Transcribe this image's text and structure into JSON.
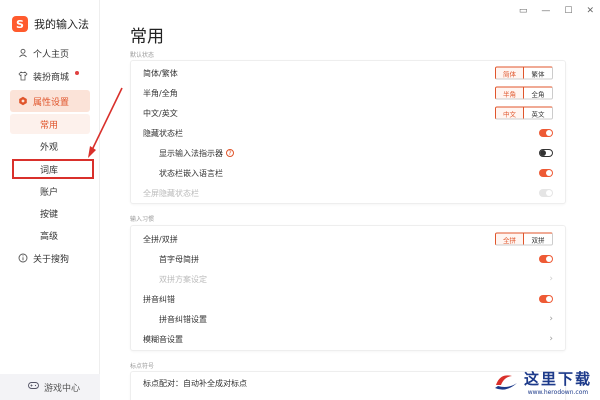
{
  "app": {
    "title": "我的输入法",
    "logo_char": "S"
  },
  "window_controls": [
    "▭",
    "—",
    "☐",
    "✕"
  ],
  "sidebar": {
    "items": [
      {
        "label": "个人主页",
        "icon": "user-icon"
      },
      {
        "label": "装扮商城",
        "icon": "shirt-icon",
        "has_dot": true
      },
      {
        "label": "属性设置",
        "icon": "settings-icon",
        "active": true
      },
      {
        "label": "常用",
        "sub": true,
        "current": true
      },
      {
        "label": "外观",
        "sub": true
      },
      {
        "label": "词库",
        "sub": true,
        "highlighted": true
      },
      {
        "label": "账户",
        "sub": true
      },
      {
        "label": "按键",
        "sub": true
      },
      {
        "label": "高级",
        "sub": true
      },
      {
        "label": "关于搜狗",
        "icon": "info-icon"
      }
    ],
    "footer": {
      "label": "游戏中心",
      "icon": "gamepad-icon"
    }
  },
  "main": {
    "title": "常用",
    "sections": [
      {
        "label": "默认状态",
        "rows": [
          {
            "label": "简体/繁体",
            "control": "segment",
            "options": [
              "简体",
              "繁体"
            ],
            "selected": 0
          },
          {
            "label": "半角/全角",
            "control": "segment",
            "options": [
              "半角",
              "全角"
            ],
            "selected": 0
          },
          {
            "label": "中文/英文",
            "control": "segment",
            "options": [
              "中文",
              "英文"
            ],
            "selected": 0
          },
          {
            "label": "隐藏状态栏",
            "control": "toggle",
            "state": "on"
          },
          {
            "label": "显示输入法指示器",
            "control": "toggle",
            "state": "off",
            "indent": true,
            "help": "?"
          },
          {
            "label": "状态栏嵌入语言栏",
            "control": "toggle",
            "state": "on",
            "indent": true
          },
          {
            "label": "全屏隐藏状态栏",
            "control": "toggle",
            "state": "disabled",
            "disabled": true
          }
        ]
      },
      {
        "label": "输入习惯",
        "rows": [
          {
            "label": "全拼/双拼",
            "control": "segment",
            "options": [
              "全拼",
              "双拼"
            ],
            "selected": 0
          },
          {
            "label": "首字母简拼",
            "control": "toggle",
            "state": "on",
            "indent": true
          },
          {
            "label": "双拼方案设定",
            "control": "chevron",
            "indent": true,
            "disabled": true
          },
          {
            "label": "拼音纠错",
            "control": "toggle",
            "state": "on"
          },
          {
            "label": "拼音纠错设置",
            "control": "chevron",
            "indent": true
          },
          {
            "label": "模糊音设置",
            "control": "chevron"
          }
        ]
      },
      {
        "label": "标点符号",
        "rows": [
          {
            "label": "标点配对：自动补全成对标点",
            "control": "none"
          }
        ]
      }
    ]
  },
  "watermark": {
    "title": "这里下载",
    "url": "www.herodown.com"
  },
  "colors": {
    "accent": "#e0552b",
    "toggle_on": "#ee5a35",
    "highlight_box": "#d9302b"
  }
}
